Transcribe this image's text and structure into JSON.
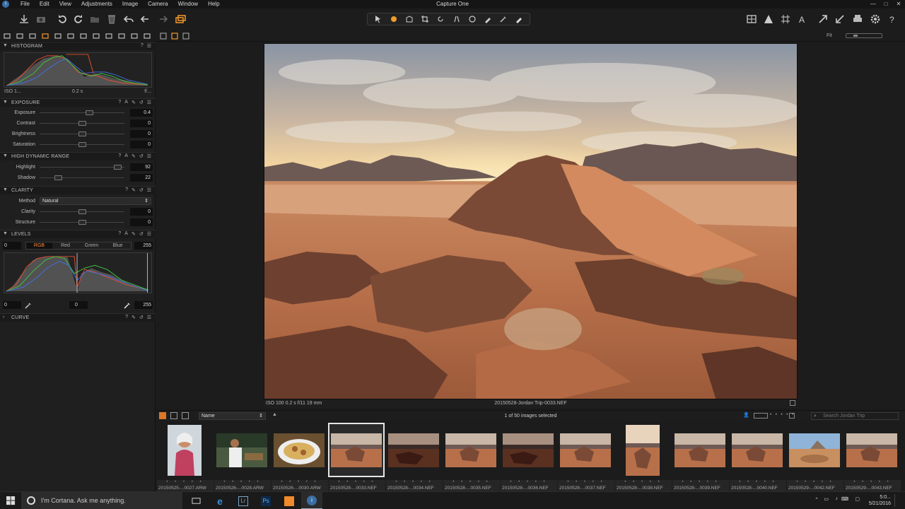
{
  "window": {
    "title": "Capture One",
    "menus": [
      "File",
      "Edit",
      "View",
      "Adjustments",
      "Image",
      "Camera",
      "Window",
      "Help"
    ],
    "controls": [
      "—",
      "□",
      "✕"
    ]
  },
  "viewer_tools": {
    "fit_label": "Fit"
  },
  "panels": {
    "histogram": {
      "title": "HISTOGRAM",
      "iso": "ISO 1...",
      "shutter": "0.2 s",
      "aperture": "f/..."
    },
    "exposure": {
      "title": "EXPOSURE",
      "sliders": [
        {
          "label": "Exposure",
          "value": "0.4",
          "pos": 0.58
        },
        {
          "label": "Contrast",
          "value": "0",
          "pos": 0.5
        },
        {
          "label": "Brightness",
          "value": "0",
          "pos": 0.5
        },
        {
          "label": "Saturation",
          "value": "0",
          "pos": 0.5
        }
      ]
    },
    "hdr": {
      "title": "HIGH DYNAMIC RANGE",
      "sliders": [
        {
          "label": "Highlight",
          "value": "92",
          "pos": 0.92
        },
        {
          "label": "Shadow",
          "value": "22",
          "pos": 0.22
        }
      ]
    },
    "clarity": {
      "title": "CLARITY",
      "method_label": "Method",
      "method_value": "Natural",
      "sliders": [
        {
          "label": "Clarity",
          "value": "0",
          "pos": 0.5
        },
        {
          "label": "Structure",
          "value": "0",
          "pos": 0.5
        }
      ]
    },
    "levels": {
      "title": "LEVELS",
      "low": "0",
      "high": "255",
      "channels": [
        "RGB",
        "Red",
        "Green",
        "Blue"
      ],
      "out_low": "0",
      "mid": "0",
      "out_high": "255"
    },
    "curve": {
      "title": "CURVE"
    }
  },
  "viewer": {
    "caption_left": "ISO 100  0.2 s  f/11  19 mm",
    "caption_center": "20150528-Jordan Trip-0033.NEF"
  },
  "browser": {
    "sort": "Name",
    "selection": "1 of 50 images selected",
    "search_placeholder": "Search Jordan Trip",
    "thumbs": [
      {
        "name": "20150525-...0027.ARW",
        "kind": "person"
      },
      {
        "name": "20150526-...0028.ARW",
        "kind": "waiter"
      },
      {
        "name": "20150526-...0030.ARW",
        "kind": "food"
      },
      {
        "name": "20150528-...0033.NEF",
        "kind": "desert",
        "selected": true
      },
      {
        "name": "20150528-...0034.NEF",
        "kind": "dark"
      },
      {
        "name": "20150528-...0035.NEF",
        "kind": "desert"
      },
      {
        "name": "20150528-...0036.NEF",
        "kind": "dark"
      },
      {
        "name": "20150528-...0037.NEF",
        "kind": "desert"
      },
      {
        "name": "20150528-...0038.NEF",
        "kind": "portrait"
      },
      {
        "name": "20150528-...0039.NEF",
        "kind": "desert"
      },
      {
        "name": "20150528-...0040.NEF",
        "kind": "desert"
      },
      {
        "name": "20150529-...0042.NEF",
        "kind": "blue"
      },
      {
        "name": "20150529-...0043.NEF",
        "kind": "desert"
      }
    ]
  },
  "taskbar": {
    "cortana": "I'm Cortana. Ask me anything.",
    "time": "5:0...",
    "date": "5/21/2016"
  },
  "colors": {
    "accent": "#ff8a3d",
    "panel_bg": "#1f1f1f",
    "bg": "#1c1c1c"
  }
}
